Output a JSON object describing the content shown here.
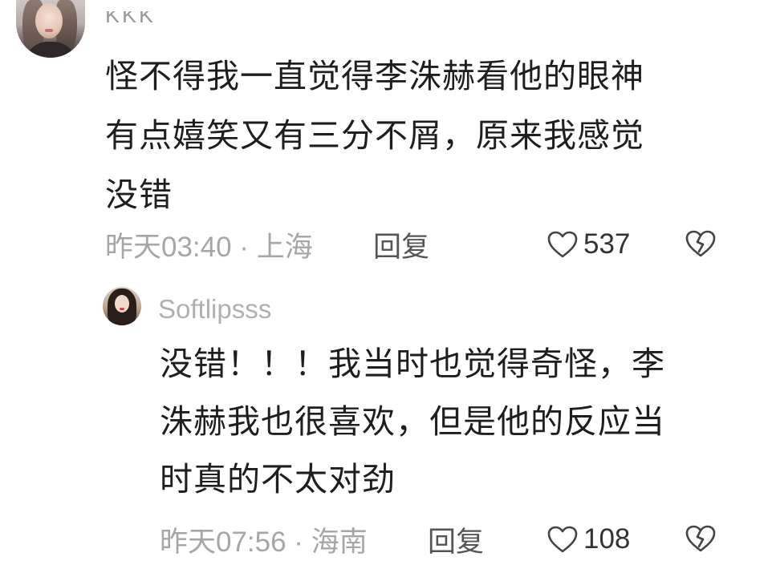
{
  "comments": [
    {
      "username": "KKK",
      "text_lines": [
        "怪不得我一直觉得李洙赫看他的眼神",
        "有点嬉笑又有三分不屑，原来我感觉",
        "没错"
      ],
      "time": "昨天03:40 · 上海",
      "reply_label": "回复",
      "likes": "537",
      "like_icon": "heart-outline-icon",
      "dislike_icon": "broken-heart-icon"
    }
  ],
  "replies": [
    {
      "username": "Softlipsss",
      "text_lines": [
        "没错！！！我当时也觉得奇怪，李",
        "洙赫我也很喜欢，但是他的反应当",
        "时真的不太对劲"
      ],
      "time": "昨天07:56 · 海南",
      "reply_label": "回复",
      "likes": "108",
      "like_icon": "heart-outline-icon",
      "dislike_icon": "broken-heart-icon"
    }
  ],
  "colors": {
    "text": "#1e1e1e",
    "meta": "#a6a6a6",
    "username": "#9a9a9a",
    "reply_button": "#555555"
  }
}
